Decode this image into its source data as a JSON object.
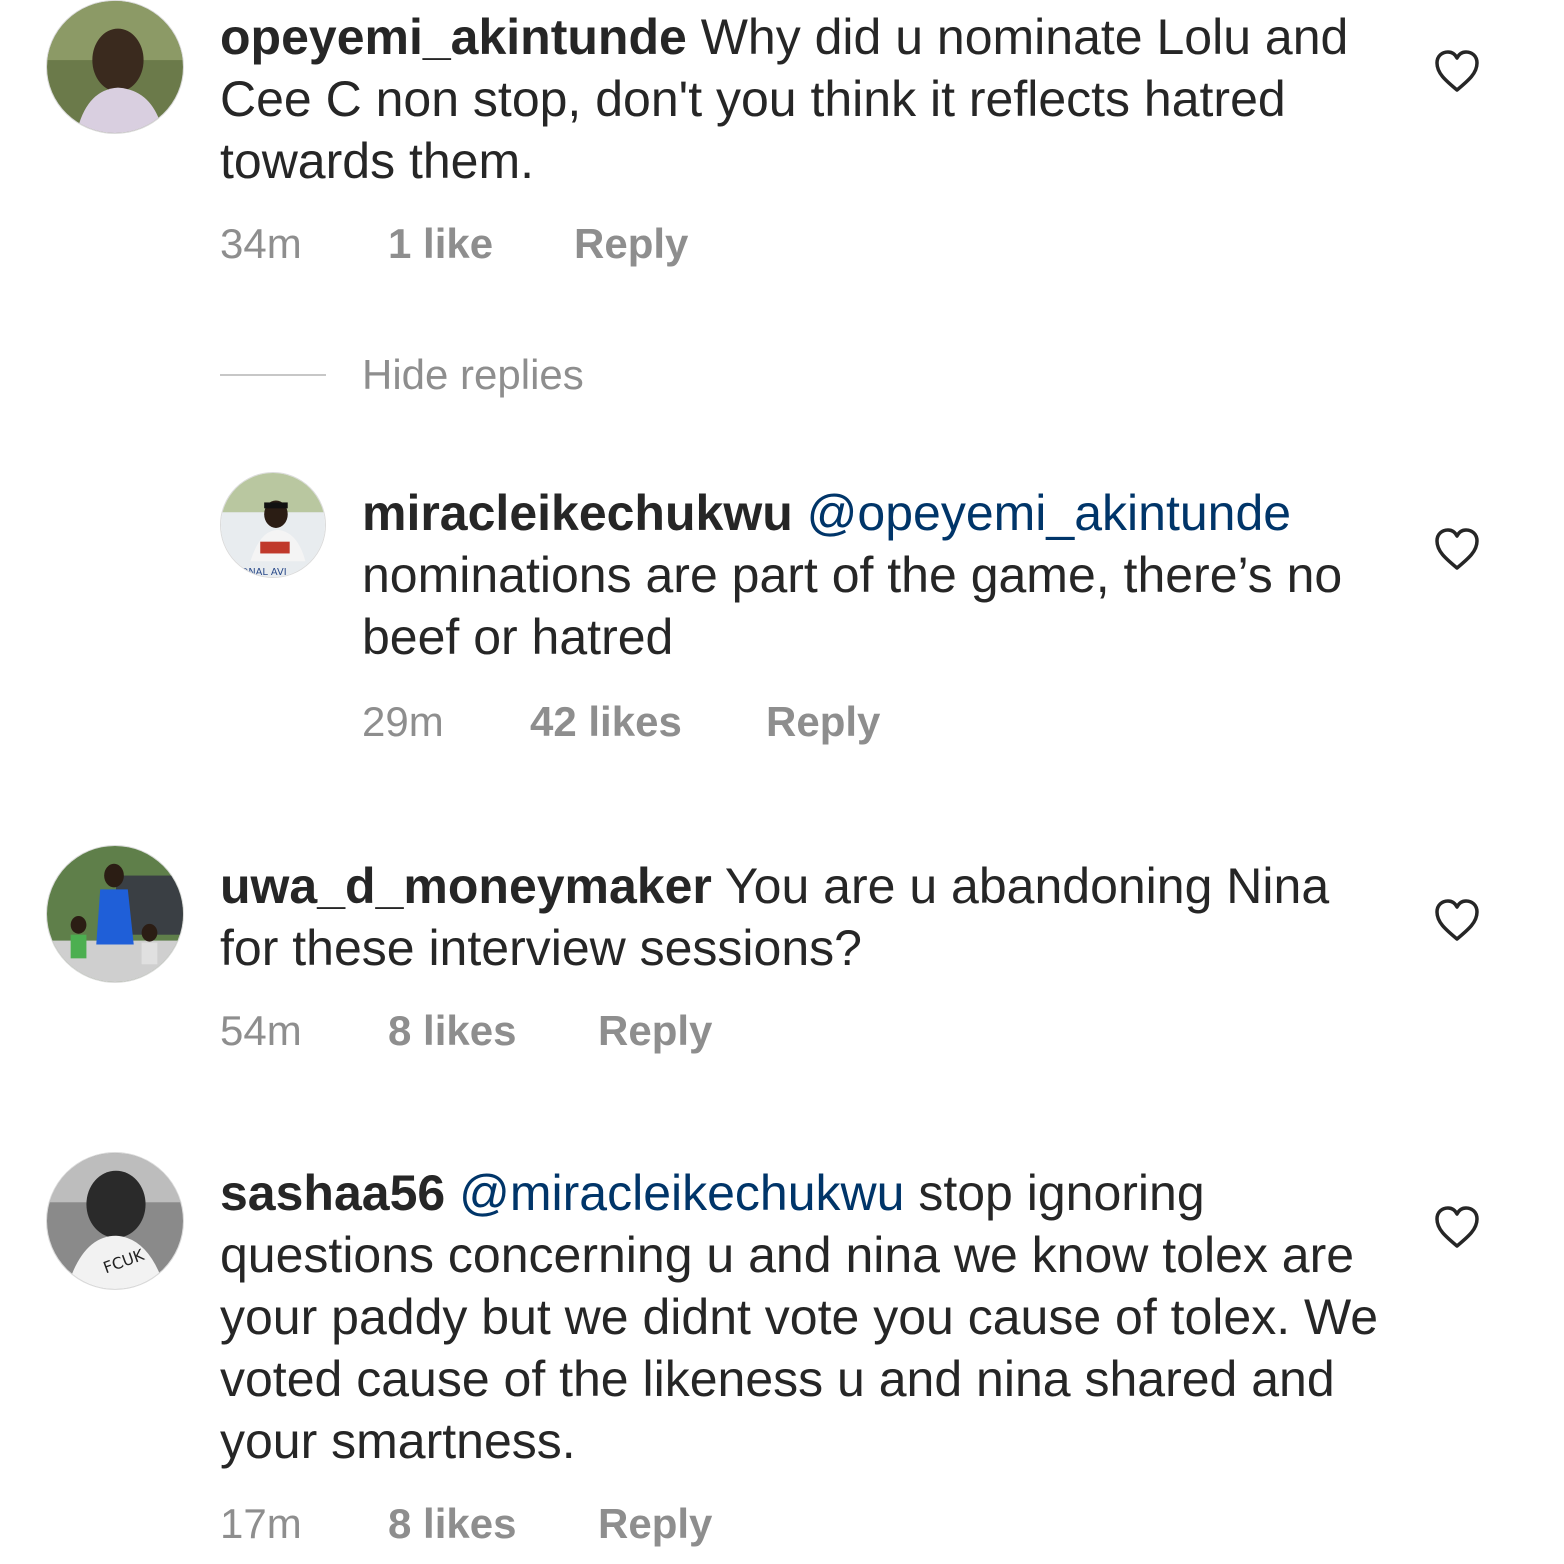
{
  "colors": {
    "text": "#262626",
    "secondary": "#8e8e8e",
    "mention": "#003569",
    "divider": "#c7c7c7"
  },
  "hide_replies_label": "Hide replies",
  "comments": [
    {
      "username": "opeyemi_akintunde",
      "mention": "",
      "text": "Why did u nominate Lolu and Cee C non stop, don't you think it reflects hatred towards them.",
      "time": "34m",
      "likes": "1 like",
      "reply_label": "Reply",
      "avatar": "profile-photo"
    },
    {
      "username": "miracleikechukwu",
      "mention": "@opeyemi_akintunde",
      "text": "nominations are part of the game, there’s no beef or hatred",
      "time": "29m",
      "likes": "42 likes",
      "reply_label": "Reply",
      "avatar": "profile-photo"
    },
    {
      "username": "uwa_d_moneymaker",
      "mention": "",
      "text": "You are u abandoning Nina for these interview sessions?",
      "time": "54m",
      "likes": "8 likes",
      "reply_label": "Reply",
      "avatar": "profile-photo"
    },
    {
      "username": "sashaa56",
      "mention": "@miracleikechukwu",
      "text": " stop ignoring questions concerning u and nina we know tolex are your paddy but we didnt vote you cause of tolex. We voted cause of the likeness  u and nina shared and your smartness.",
      "time": "17m",
      "likes": "8 likes",
      "reply_label": "Reply",
      "avatar": "profile-photo"
    }
  ]
}
